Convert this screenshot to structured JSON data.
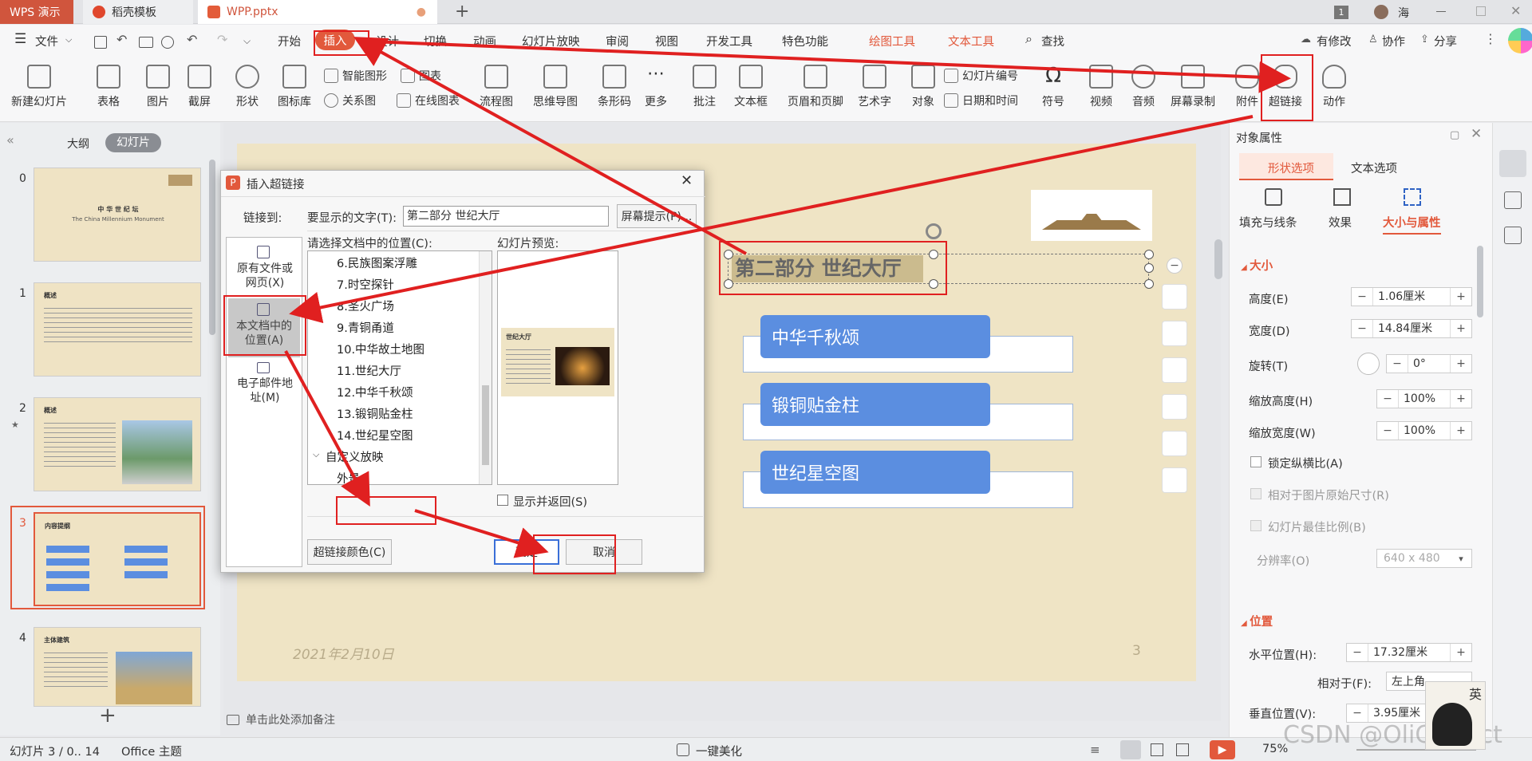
{
  "titlebar": {
    "app_tab": "WPS 演示",
    "template_tab": "稻壳模板",
    "doc_tab": "WPP.pptx",
    "new_tab": "+",
    "badge": "1",
    "user": "海"
  },
  "menu": {
    "file": "文件",
    "items": [
      "开始",
      "插入",
      "设计",
      "切换",
      "动画",
      "幻灯片放映",
      "审阅",
      "视图",
      "开发工具",
      "特色功能"
    ],
    "drawing_tools": "绘图工具",
    "text_tools": "文本工具",
    "search": "查找",
    "right": [
      "有修改",
      "协作",
      "分享"
    ]
  },
  "ribbon": {
    "new_slide": "新建幻灯片",
    "table": "表格",
    "picture": "图片",
    "screenshot": "截屏",
    "shape": "形状",
    "icon_lib": "图标库",
    "smart_shape": "智能图形",
    "chart": "图表",
    "relation": "关系图",
    "online_chart": "在线图表",
    "flowchart": "流程图",
    "mindmap": "思维导图",
    "barcode": "条形码",
    "more": "更多",
    "comment": "批注",
    "textbox": "文本框",
    "header_footer": "页眉和页脚",
    "wordart": "艺术字",
    "object": "对象",
    "slide_number": "幻灯片编号",
    "datetime": "日期和时间",
    "symbol": "符号",
    "video": "视频",
    "audio": "音频",
    "screen_record": "屏幕录制",
    "attachment": "附件",
    "hyperlink": "超链接",
    "action": "动作"
  },
  "left_panel": {
    "tab_outline": "大纲",
    "tab_slides": "幻灯片",
    "slides": [
      {
        "num": "0",
        "title": "中 华 世 纪 坛",
        "subtitle": "The China Millennium Monument"
      },
      {
        "num": "1",
        "title": "概述"
      },
      {
        "num": "2",
        "title": "概述"
      },
      {
        "num": "3",
        "title": "内容提纲"
      },
      {
        "num": "4",
        "title": "主体建筑"
      }
    ],
    "add": "+"
  },
  "slide": {
    "heading": "第二部分  世纪大厅",
    "items": [
      "中华千秋颂",
      "锻铜贴金柱",
      "世纪星空图"
    ],
    "date": "2021年2月10日",
    "page": "3",
    "notes_placeholder": "单击此处添加备注"
  },
  "dialog": {
    "title": "插入超链接",
    "link_to": "链接到:",
    "display_text_label": "要显示的文字(T):",
    "display_text_value": "第二部分 世纪大厅",
    "screen_tip": "屏幕提示(P)...",
    "nav": [
      "原有文件或网页(X)",
      "本文档中的位置(A)",
      "电子邮件地址(M)"
    ],
    "select_label": "请选择文档中的位置(C):",
    "preview_label": "幻灯片预览:",
    "list": [
      "6.民族图案浮雕",
      "7.时空探针",
      "8.圣火广场",
      "9.青铜甬道",
      "10.中华故土地图",
      "11.世纪大厅",
      "12.中华千秋颂",
      "13.锻铜贴金柱",
      "14.世纪星空图"
    ],
    "custom_show_group": "自定义放映",
    "custom_show_items": [
      "外景",
      "大厅"
    ],
    "show_and_return": "显示并返回(S)",
    "hyperlink_color": "超链接颜色(C)",
    "ok": "确定",
    "cancel": "取消",
    "preview_title": "世纪大厅"
  },
  "right_pane": {
    "title": "对象属性",
    "tab_shape": "形状选项",
    "tab_text": "文本选项",
    "sub_fill": "填充与线条",
    "sub_effect": "效果",
    "sub_size": "大小与属性",
    "section_size": "大小",
    "height_label": "高度(E)",
    "height_value": "1.06厘米",
    "width_label": "宽度(D)",
    "width_value": "14.84厘米",
    "rotate_label": "旋转(T)",
    "rotate_value": "0°",
    "scale_h_label": "缩放高度(H)",
    "scale_h_value": "100%",
    "scale_w_label": "缩放宽度(W)",
    "scale_w_value": "100%",
    "lock_ratio": "锁定纵横比(A)",
    "relative_orig": "相对于图片原始尺寸(R)",
    "best_ratio": "幻灯片最佳比例(B)",
    "resolution_label": "分辨率(O)",
    "resolution_value": "640 x 480",
    "section_position": "位置",
    "hpos_label": "水平位置(H):",
    "hpos_value": "17.32厘米",
    "relative_to": "相对于(F):",
    "relative_value": "左上角",
    "vpos_label": "垂直位置(V):",
    "vpos_value": "3.95厘米"
  },
  "statusbar": {
    "slide_info": "幻灯片 3 / 0.. 14",
    "theme": "Office 主题",
    "beautify": "一键美化",
    "zoom": "75%"
  },
  "watermark": "CSDN @OliCorrect",
  "colors": {
    "accent": "#d0553d",
    "blue_box": "#5b8ee0",
    "annotation": "#e02020",
    "slide_bg": "#efe4c5"
  }
}
